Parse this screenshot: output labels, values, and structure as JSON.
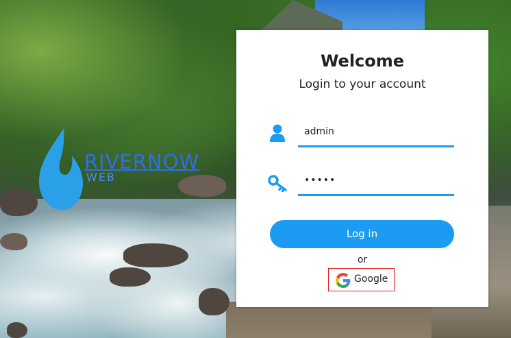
{
  "logo": {
    "name": "RIVERNOW",
    "sub": "WEB"
  },
  "login": {
    "title": "Welcome",
    "subtitle": "Login to your account",
    "username_value": "admin",
    "password_value": "•••••",
    "login_button": "Log in",
    "or_text": "or",
    "google_button": "Google"
  },
  "icons": {
    "user": "user-icon",
    "key": "key-icon",
    "google": "google-icon"
  },
  "colors": {
    "accent": "#1b9cf2",
    "google_border": "#e31b1b",
    "logo": "#2d6fe6"
  }
}
